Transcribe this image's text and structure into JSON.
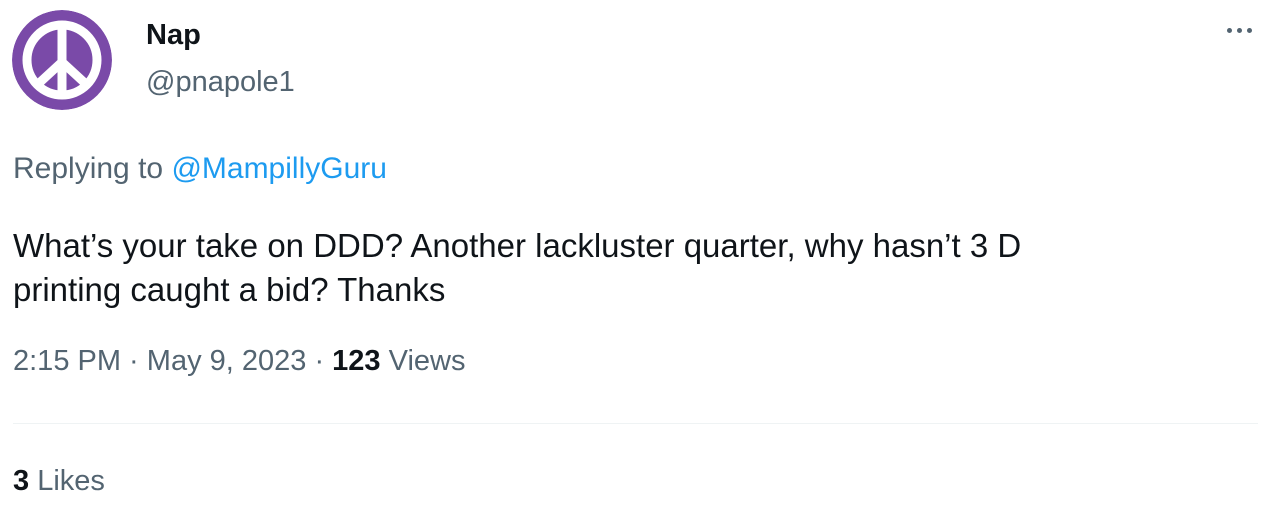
{
  "author": {
    "name": "Nap",
    "handle": "@pnapole1",
    "avatar_icon": "peace-sign-icon",
    "avatar_color": "#7a4aa8"
  },
  "reply": {
    "prefix": "Replying to",
    "to_handle": "@MampillyGuru"
  },
  "tweet_text": "What’s your take on DDD? Another lackluster quarter, why hasn’t 3 D\nprinting caught a bid?  Thanks",
  "meta": {
    "time": "2:15 PM",
    "separator1": " · ",
    "date": "May 9, 2023",
    "separator2": " · ",
    "views_count": "123",
    "views_label": "Views"
  },
  "stats": {
    "likes_count": "3",
    "likes_label": "Likes"
  },
  "colors": {
    "link": "#1d9bf0",
    "secondary_text": "#536471",
    "primary_text": "#0f1419"
  },
  "more_icon": "more-dots-icon"
}
